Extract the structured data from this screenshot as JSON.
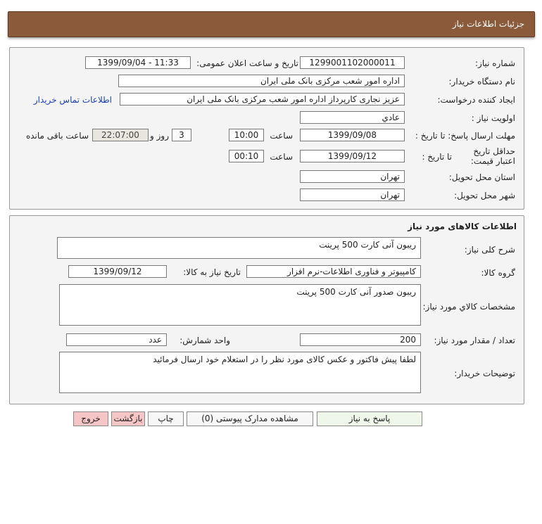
{
  "header": {
    "title": "جزئیات اطلاعات نیاز"
  },
  "info": {
    "need_number_label": "شماره نیاز:",
    "need_number": "1299001102000011",
    "announce_label": "تاریخ و ساعت اعلان عمومی:",
    "announce_value": "1399/09/04 - 11:33",
    "buyer_org_label": "نام دستگاه خریدار:",
    "buyer_org": "اداره امور شعب مرکزی بانک ملی ایران",
    "requester_label": "ایجاد کننده درخواست:",
    "requester": "عزیز نجاری کارپرداز اداره امور شعب مرکزی بانک ملی ایران",
    "contact_link": "اطلاعات تماس خریدار",
    "priority_label": "اولویت نیاز :",
    "priority": "عادي",
    "deadline_label": "مهلت ارسال پاسخ: تا تاریخ :",
    "deadline_date": "1399/09/08",
    "time_label": "ساعت",
    "deadline_time": "10:00",
    "days_value": "3",
    "days_label": "روز و",
    "remaining_time": "22:07:00",
    "remaining_label": "ساعت باقی مانده",
    "validity_label": "حداقل تاریخ اعتبار قیمت:",
    "validity_until_label": "تا تاریخ :",
    "validity_date": "1399/09/12",
    "validity_time_label": "ساعت",
    "validity_time": "00:10",
    "province_label": "استان محل تحویل:",
    "province": "تهران",
    "city_label": "شهر محل تحویل:",
    "city": "تهران"
  },
  "goods": {
    "section_title": "اطلاعات کالاهای مورد نیاز",
    "general_desc_label": "شرح کلی نیاز:",
    "general_desc": "ریبون آنی کارت 500 پرینت",
    "group_label": "گروه کالا:",
    "group": "کامپیوتر و فناوری اطلاعات-نرم افزار",
    "need_date_label": "تاریخ نیاز به کالا:",
    "need_date": "1399/09/12",
    "spec_label": "مشخصات کالاي مورد نیاز:",
    "spec": "ریبون صدور آنی کارت 500 پرینت",
    "quantity_label": "تعداد / مقدار مورد نیاز:",
    "quantity": "200",
    "unit_label": "واحد شمارش:",
    "unit": "عدد",
    "buyer_notes_label": "توضیحات خریدار:",
    "buyer_notes": "لطفا پیش فاکتور و عکس کالای مورد نظر را در استعلام خود ارسال فرمائید"
  },
  "buttons": {
    "reply": "پاسخ به نیاز",
    "attachments": "مشاهده مدارک پیوستی (0)",
    "print": "چاپ",
    "back": "بازگشت",
    "exit": "خروج"
  }
}
